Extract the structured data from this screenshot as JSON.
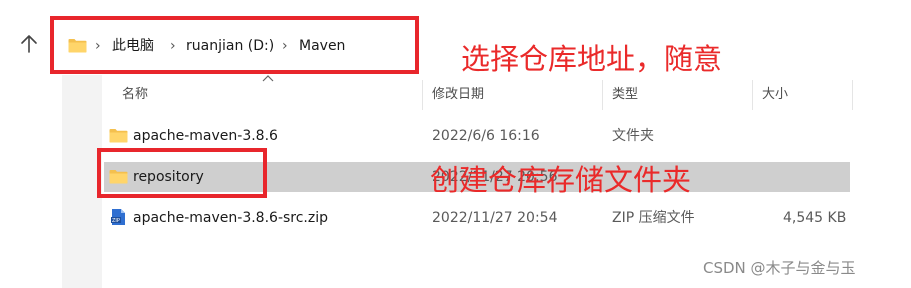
{
  "breadcrumb": {
    "items": [
      "此电脑",
      "ruanjian (D:)",
      "Maven"
    ]
  },
  "columns": {
    "name": "名称",
    "modified": "修改日期",
    "type": "类型",
    "size": "大小"
  },
  "files": [
    {
      "name": "apache-maven-3.8.6",
      "modified": "2022/6/6 16:16",
      "type": "文件夹",
      "size": "",
      "icon": "folder-icon"
    },
    {
      "name": "repository",
      "modified": "2022/11/27 20:56",
      "type": "",
      "size": "",
      "icon": "folder-icon",
      "selected": true
    },
    {
      "name": "apache-maven-3.8.6-src.zip",
      "modified": "2022/11/27 20:54",
      "type": "ZIP 压缩文件",
      "size": "4,545 KB",
      "icon": "zip-icon"
    }
  ],
  "annotations": {
    "address": "选择仓库地址，随意",
    "folder": "创建仓库存储文件夹"
  },
  "watermark": "CSDN @木子与金与玉",
  "colors": {
    "annotation": "#e8262c",
    "selection": "#cfcfcf",
    "folder": "#f4c04e"
  }
}
